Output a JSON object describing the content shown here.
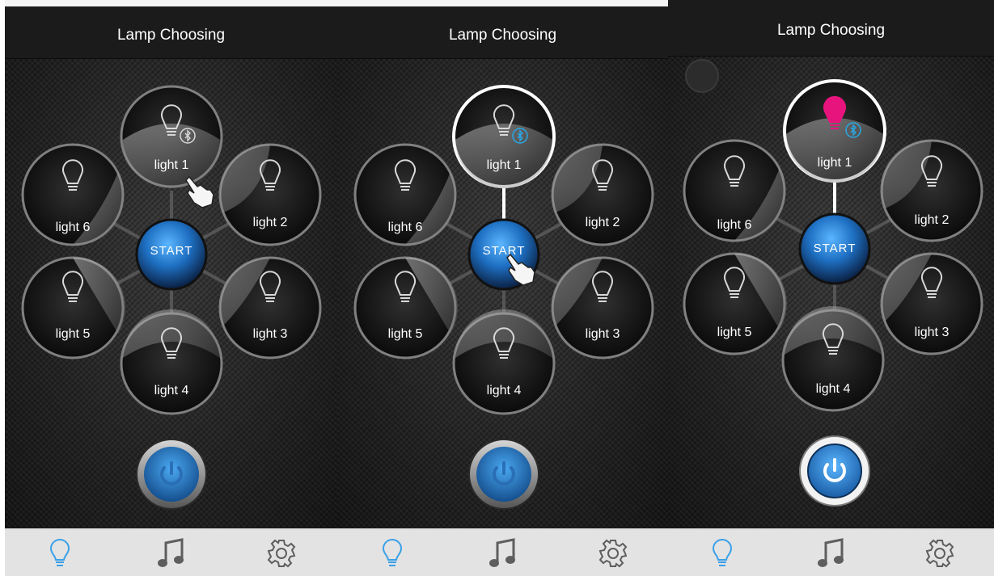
{
  "screens": [
    {
      "nav_title": "Lamp Choosing",
      "lights": [
        {
          "label": "light 1"
        },
        {
          "label": "light 2"
        },
        {
          "label": "light 3"
        },
        {
          "label": "light 4"
        },
        {
          "label": "light 5"
        },
        {
          "label": "light 6"
        }
      ],
      "start_label": "START",
      "tabs": [
        {
          "icon": "bulb-icon",
          "active": true
        },
        {
          "icon": "music-note-icon",
          "active": false
        },
        {
          "icon": "gear-icon",
          "active": false
        }
      ]
    },
    {
      "nav_title": "Lamp Choosing",
      "lights": [
        {
          "label": "light 1"
        },
        {
          "label": "light 2"
        },
        {
          "label": "light 3"
        },
        {
          "label": "light 4"
        },
        {
          "label": "light 5"
        },
        {
          "label": "light 6"
        }
      ],
      "start_label": "START",
      "tabs": [
        {
          "icon": "bulb-icon",
          "active": true
        },
        {
          "icon": "music-note-icon",
          "active": false
        },
        {
          "icon": "gear-icon",
          "active": false
        }
      ]
    },
    {
      "nav_title": "Lamp Choosing",
      "lights": [
        {
          "label": "light 1"
        },
        {
          "label": "light 2"
        },
        {
          "label": "light 3"
        },
        {
          "label": "light 4"
        },
        {
          "label": "light 5"
        },
        {
          "label": "light 6"
        }
      ],
      "start_label": "START",
      "tabs": [
        {
          "icon": "bulb-icon",
          "active": true
        },
        {
          "icon": "music-note-icon",
          "active": false
        },
        {
          "icon": "gear-icon",
          "active": false
        }
      ]
    }
  ],
  "colors": {
    "accent_blue": "#2b8fe0",
    "selected_bulb": "#e8147e",
    "bluetooth": "#29a8e6",
    "tab_active": "#3aa0e8",
    "tab_inactive": "#5e5e5e"
  }
}
